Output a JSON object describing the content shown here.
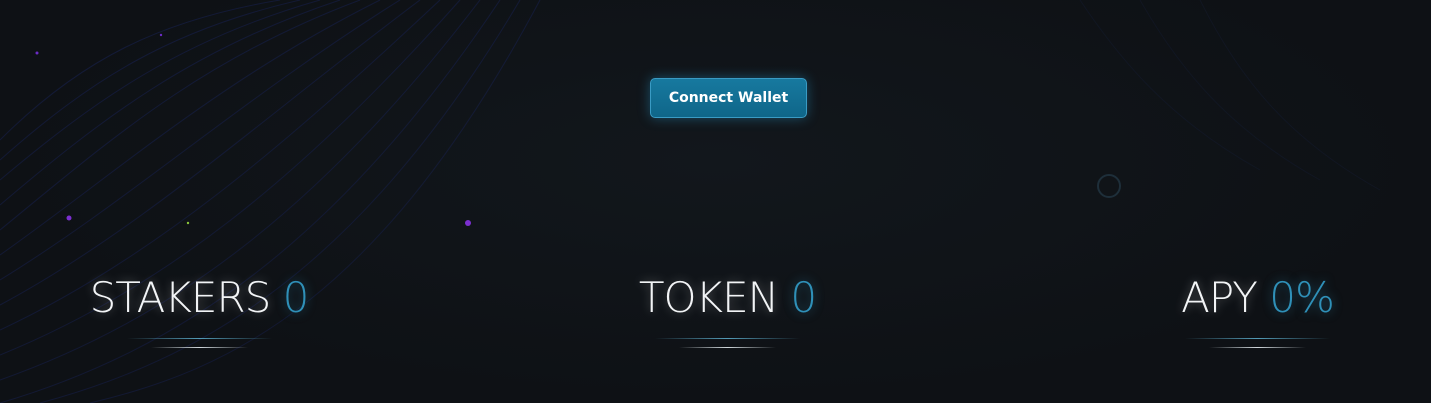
{
  "header": {
    "connect_wallet_label": "Connect Wallet"
  },
  "stats": {
    "stakers": {
      "label": "STAKERS",
      "value": "0"
    },
    "token": {
      "label": "TOKEN",
      "value": "0"
    },
    "apy": {
      "label": "APY",
      "value": "0%"
    }
  },
  "colors": {
    "background": "#0f1216",
    "accent": "#2f90b8",
    "button": "#17799f",
    "text": "#f2f4f6"
  }
}
